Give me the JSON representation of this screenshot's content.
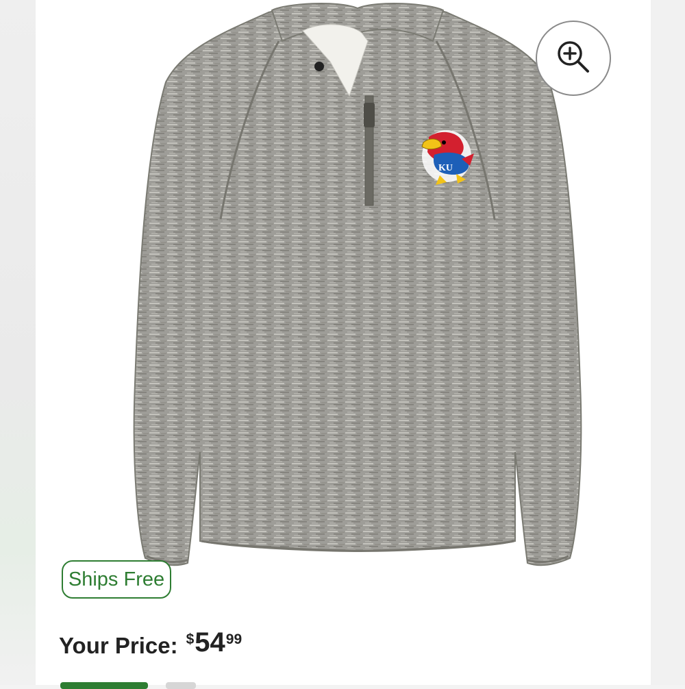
{
  "product": {
    "image_alt": "Kansas Jayhawks heather gray quarter-zip pullover",
    "logo_text": "KU"
  },
  "zoom": {
    "icon": "zoom-in-icon"
  },
  "badge": {
    "label": "Ships Free",
    "color": "#2e7d32"
  },
  "price": {
    "label": "Your Price:",
    "currency": "$",
    "dollars": "54",
    "cents": "99"
  }
}
